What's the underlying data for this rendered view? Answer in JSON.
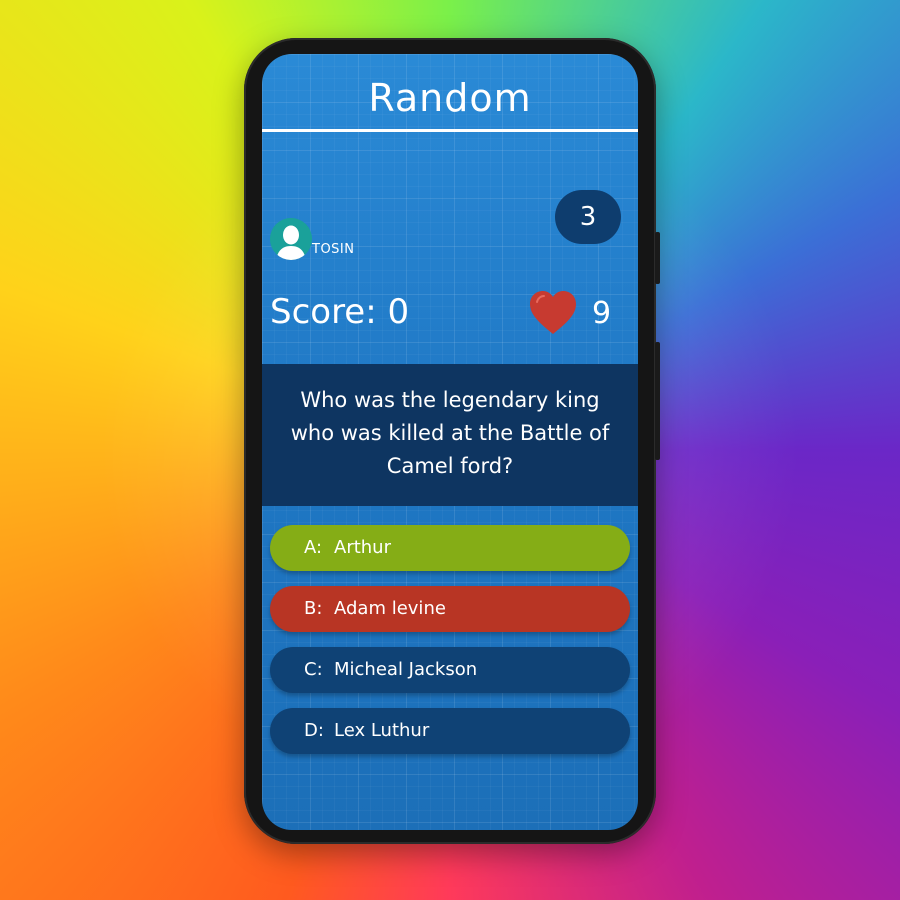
{
  "header": {
    "title": "Random"
  },
  "player": {
    "name": "TOSIN",
    "badge": "3"
  },
  "stats": {
    "score": "Score: 0",
    "lives": "9"
  },
  "question": {
    "text": "Who was the legendary king who was killed at the Battle of Camel ford?"
  },
  "options": [
    {
      "letter": "A:",
      "text": "Arthur",
      "color": "#85ad16"
    },
    {
      "letter": "B:",
      "text": "Adam levine",
      "color": "#b83524"
    },
    {
      "letter": "C:",
      "text": "Micheal Jackson",
      "color": "#0f4275"
    },
    {
      "letter": "D:",
      "text": "Lex Luthur",
      "color": "#0f4275"
    }
  ],
  "icons": {
    "avatar": "user-avatar-icon",
    "lives": "heart-icon"
  }
}
